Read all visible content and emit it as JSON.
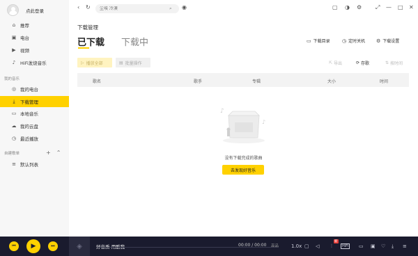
{
  "sidebar": {
    "login_label": "点此登录",
    "items_top": [
      {
        "icon": "home-icon",
        "glyph": "⌂",
        "label": "推荐"
      },
      {
        "icon": "radio-icon",
        "glyph": "▣",
        "label": "电台"
      },
      {
        "icon": "video-icon",
        "glyph": "▶",
        "label": "视频"
      },
      {
        "icon": "hifi-icon",
        "glyph": "♪",
        "label": "HiFi发烧音乐"
      }
    ],
    "section_my_music": "我的音乐",
    "items_my": [
      {
        "icon": "my-radio-icon",
        "glyph": "◎",
        "label": "我的电台"
      },
      {
        "icon": "download-icon",
        "glyph": "⤓",
        "label": "下载管理",
        "active": true
      },
      {
        "icon": "local-music-icon",
        "glyph": "▭",
        "label": "本地音乐"
      },
      {
        "icon": "cloud-icon",
        "glyph": "☁",
        "label": "我的云盘"
      },
      {
        "icon": "history-icon",
        "glyph": "◷",
        "label": "最近播放"
      }
    ],
    "section_playlists": "自建歌单",
    "items_playlists": [
      {
        "icon": "playlist-icon",
        "glyph": "≡",
        "label": "默认列表"
      }
    ]
  },
  "topbar": {
    "search_placeholder": "尘埃 冷漠"
  },
  "main": {
    "title": "下载管理",
    "tab_downloaded": "已下载",
    "tab_downloading": "下载中",
    "actions": {
      "download_dir": "下载目录",
      "timer_shutdown": "定时关机",
      "download_settings": "下载设置"
    },
    "buttons": {
      "play_all": "播放全部",
      "batch": "批量操作"
    },
    "tools": {
      "export": "导出",
      "save_playlist": "存歌",
      "sort_time": "按时间"
    },
    "columns": [
      "歌名",
      "歌手",
      "专辑",
      "大小",
      "时间"
    ],
    "empty_text": "没有下载完成的歌曲",
    "discover_button": "去发现好音乐"
  },
  "player": {
    "song": "好音质 用酷我",
    "time": "00:00 / 00:00",
    "quality": "高品",
    "speed": "1.0x",
    "badge": "新"
  },
  "colors": {
    "accent": "#ffd100",
    "player_bg": "#1a1b2e",
    "sidebar_bg": "#f7f7f7"
  }
}
